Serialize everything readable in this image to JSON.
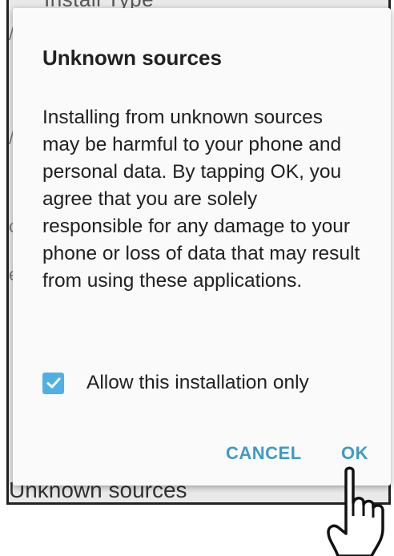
{
  "background": {
    "top_text": "Install Type",
    "bottom_text": "Unknown sources"
  },
  "dialog": {
    "title": "Unknown sources",
    "body": "Installing from unknown sources may be harmful to your phone and personal data. By tapping OK, you agree that you are solely responsible for any damage to your phone or loss of data that may result from using these applications.",
    "checkbox_label": "Allow this installation only",
    "checkbox_checked": true,
    "cancel_label": "CANCEL",
    "ok_label": "OK"
  },
  "colors": {
    "accent": "#3e9bc4",
    "checkbox": "#4fb1e3",
    "dialog_bg": "#fafafa",
    "text": "#212121"
  }
}
